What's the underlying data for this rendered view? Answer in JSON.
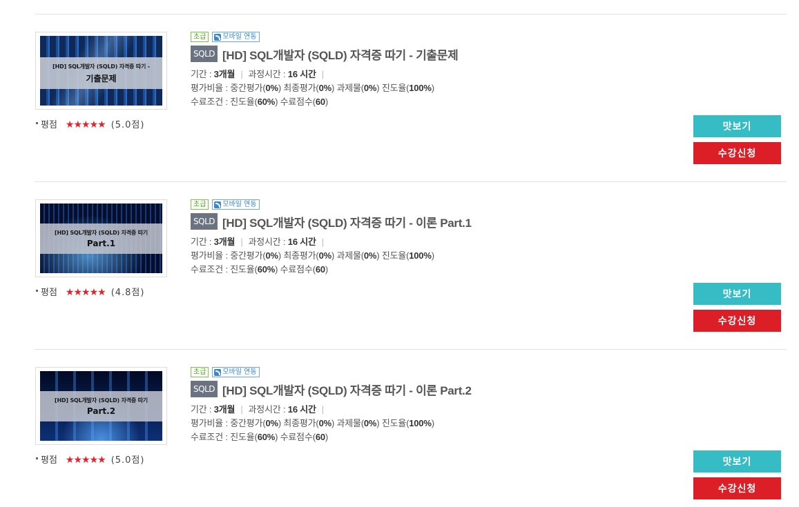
{
  "courses": [
    {
      "level": "초급",
      "mobile": "모바일 연동",
      "category": "SQLD",
      "title": "[HD] SQL개발자 (SQLD) 자격증 따기 - 기출문제",
      "thumb_line1": "[HD] SQL개발자 (SQLD) 자격증 따기 -",
      "thumb_line2": "기출문제",
      "period_label": "기간 : ",
      "period": "3개월",
      "hours_label": "과정시간 : ",
      "hours": "16 시간",
      "weights_label": "평가비율 : ",
      "mid_label": "중간평가(",
      "mid": "0%",
      "final_label": ") 최종평가(",
      "final": "0%",
      "assign_label": ") 과제물(",
      "assign": "0%",
      "prog_label": ") 진도율(",
      "prog": "100%",
      "complete_label": "수료조건 : 진도율(",
      "complete_prog": "60%",
      "complete_score_label": ") 수료점수(",
      "complete_score": "60",
      "rating_label": "평점",
      "stars": "★★★★★",
      "score": "(5.0점)",
      "rating_value": 5.0,
      "preview": "맛보기",
      "enroll": "수강신청"
    },
    {
      "level": "초급",
      "mobile": "모바일 연동",
      "category": "SQLD",
      "title": "[HD] SQL개발자 (SQLD) 자격증 따기 - 이론 Part.1",
      "thumb_line1": "[HD] SQL개발자 (SQLD) 자격증 따기",
      "thumb_line2": "Part.1",
      "period_label": "기간 : ",
      "period": "3개월",
      "hours_label": "과정시간 : ",
      "hours": "16 시간",
      "weights_label": "평가비율 : ",
      "mid_label": "중간평가(",
      "mid": "0%",
      "final_label": ") 최종평가(",
      "final": "0%",
      "assign_label": ") 과제물(",
      "assign": "0%",
      "prog_label": ") 진도율(",
      "prog": "100%",
      "complete_label": "수료조건 : 진도율(",
      "complete_prog": "60%",
      "complete_score_label": ") 수료점수(",
      "complete_score": "60",
      "rating_label": "평점",
      "stars": "★★★★★",
      "score": "(4.8점)",
      "rating_value": 4.8,
      "preview": "맛보기",
      "enroll": "수강신청"
    },
    {
      "level": "초급",
      "mobile": "모바일 연동",
      "category": "SQLD",
      "title": "[HD] SQL개발자 (SQLD) 자격증 따기 - 이론 Part.2",
      "thumb_line1": "[HD] SQL개발자 (SQLD) 자격증 따기",
      "thumb_line2": "Part.2",
      "period_label": "기간 : ",
      "period": "3개월",
      "hours_label": "과정시간 : ",
      "hours": "16 시간",
      "weights_label": "평가비율 : ",
      "mid_label": "중간평가(",
      "mid": "0%",
      "final_label": ") 최종평가(",
      "final": "0%",
      "assign_label": ") 과제물(",
      "assign": "0%",
      "prog_label": ") 진도율(",
      "prog": "100%",
      "complete_label": "수료조건 : 진도율(",
      "complete_prog": "60%",
      "complete_score_label": ") 수료점수(",
      "complete_score": "60",
      "rating_label": "평점",
      "stars": "★★★★★",
      "score": "(5.0점)",
      "rating_value": 5.0,
      "preview": "맛보기",
      "enroll": "수강신청"
    }
  ],
  "colors": {
    "preview_button": "#36bcc4",
    "enroll_button": "#dc1f26",
    "star": "#e0242b",
    "level_badge": "#59a827",
    "mobile_badge": "#3a86d0",
    "category_tag": "#6b7380"
  },
  "icons": {
    "mobile_badge_icon": "rss-icon",
    "rating_bullet": "bullet-icon",
    "rating_stars": "star-icon"
  }
}
